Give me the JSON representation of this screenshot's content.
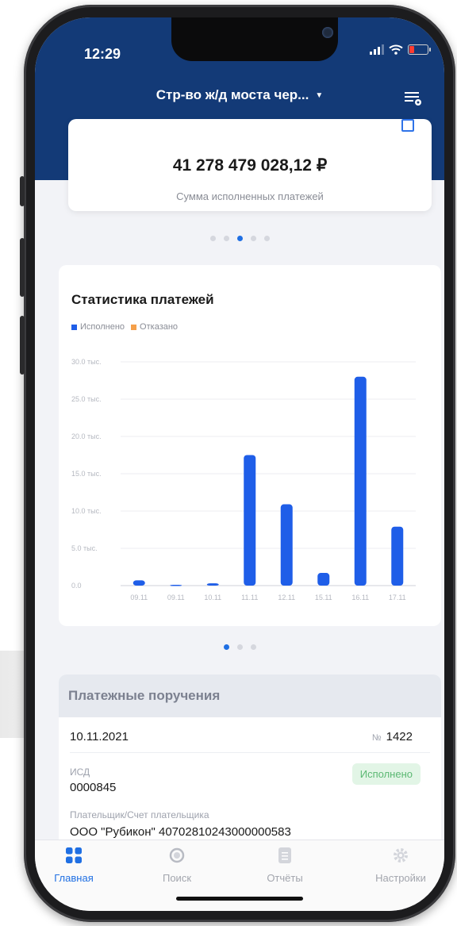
{
  "status_bar": {
    "time": "12:29"
  },
  "header": {
    "title": "Стр-во ж/д моста чер..."
  },
  "summary": {
    "amount": "41 278 479 028,12 ₽",
    "label": "Сумма исполненных платежей"
  },
  "carousel_top": {
    "count": 5,
    "active": 2
  },
  "chart_card": {
    "title": "Статистика платежей",
    "legend": [
      {
        "name": "Исполнено",
        "color": "#1f5ee8"
      },
      {
        "name": "Отказано",
        "color": "#f5a04a"
      }
    ]
  },
  "chart_data": {
    "type": "bar",
    "title": "Статистика платежей",
    "categories": [
      "09.11",
      "09.11",
      "10.11",
      "11.11",
      "12.11",
      "15.11",
      "16.11",
      "17.11"
    ],
    "series": [
      {
        "name": "Исполнено",
        "values": [
          700,
          100,
          300,
          17500,
          10900,
          1700,
          28000,
          7900
        ]
      },
      {
        "name": "Отказано",
        "values": [
          0,
          0,
          0,
          0,
          0,
          0,
          0,
          0
        ]
      }
    ],
    "y_ticks": [
      "0.0",
      "5.0 тыс.",
      "10.0 тыс.",
      "15.0 тыс.",
      "20.0 тыс.",
      "25.0 тыс.",
      "30.0 тыс."
    ],
    "ylim": [
      0,
      30000
    ],
    "grid": true,
    "legend_position": "top-left"
  },
  "carousel_bottom": {
    "count": 3,
    "active": 0
  },
  "orders": {
    "title": "Платежные поручения",
    "date": "10.11.2021",
    "number_label": "№",
    "number": "1422",
    "isd_label": "ИСД",
    "isd_value": "0000845",
    "status": "Исполнено",
    "payer_label": "Плательщик/Счет плательщика",
    "payer_value": "ООО \"Рубикон\" 40702810243000000583"
  },
  "tabs": [
    {
      "label": "Главная",
      "icon": "grid-icon",
      "active": true
    },
    {
      "label": "Поиск",
      "icon": "search-icon",
      "active": false
    },
    {
      "label": "Отчёты",
      "icon": "document-icon",
      "active": false
    },
    {
      "label": "Настройки",
      "icon": "gear-icon",
      "active": false
    }
  ]
}
